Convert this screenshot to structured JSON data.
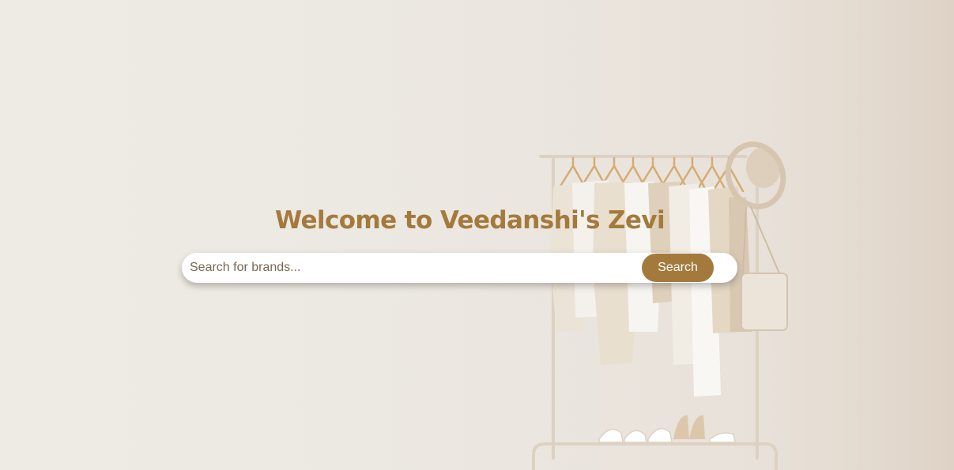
{
  "hero": {
    "title": "Welcome to Veedanshi's Zevi"
  },
  "search": {
    "placeholder": "Search for brands...",
    "value": "",
    "button_label": "Search"
  },
  "colors": {
    "accent": "#a47a3c",
    "background": "#ece8e2"
  }
}
